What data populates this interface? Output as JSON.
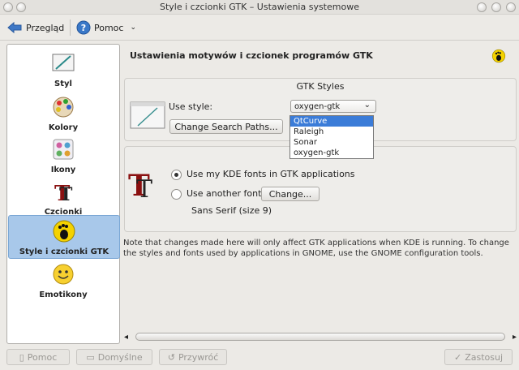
{
  "window": {
    "title": "Style i czcionki GTK – Ustawienia systemowe"
  },
  "toolbar": {
    "back_label": "Przegląd",
    "help_label": "Pomoc"
  },
  "sidebar": {
    "items": [
      {
        "label": "Styl",
        "icon": "brush-icon"
      },
      {
        "label": "Kolory",
        "icon": "palette-icon"
      },
      {
        "label": "Ikony",
        "icon": "icons-icon"
      },
      {
        "label": "Czcionki",
        "icon": "font-icon"
      },
      {
        "label": "Style i czcionki GTK",
        "icon": "gnome-foot-icon",
        "selected": true
      },
      {
        "label": "Emotikony",
        "icon": "smiley-icon"
      }
    ]
  },
  "main": {
    "header": "Ustawienia motywów i czcionek programów GTK",
    "gtk_styles": {
      "title": "GTK Styles",
      "use_style_label": "Use style:",
      "selected_style": "oxygen-gtk",
      "change_paths_button": "Change Search Paths...",
      "options": [
        "QtCurve",
        "Raleigh",
        "Sonar",
        "oxygen-gtk"
      ],
      "highlighted_option": "QtCurve"
    },
    "fonts": {
      "kde_fonts_label": "Use my KDE fonts in GTK applications",
      "another_font_label": "Use another font:",
      "change_button": "Change...",
      "font_name": "Sans Serif (size 9)"
    },
    "note": "Note that changes made here will only affect GTK applications when KDE is running.  To change the styles and fonts used by applications in GNOME, use the GNOME configuration tools."
  },
  "buttons": {
    "help": "Pomoc",
    "defaults": "Domyślne",
    "reset": "Przywróć",
    "apply": "Zastosuj"
  },
  "colors": {
    "selection": "#a8c8ea",
    "highlight": "#3b7cd8"
  }
}
